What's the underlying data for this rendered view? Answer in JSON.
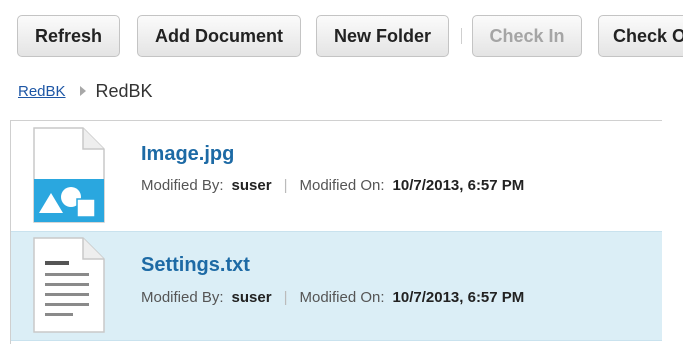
{
  "toolbar": {
    "buttons": [
      {
        "label": "Refresh",
        "enabled": true
      },
      {
        "label": "Add Document",
        "enabled": true
      },
      {
        "label": "New Folder",
        "enabled": true
      },
      {
        "label": "Check In",
        "enabled": false
      },
      {
        "label": "Check O",
        "enabled": true
      }
    ]
  },
  "breadcrumb": {
    "link": "RedBK",
    "current": "RedBK"
  },
  "files": [
    {
      "name": "Image.jpg",
      "icon": "image-file-icon",
      "modified_by_label": "Modified By:",
      "modified_by": "suser",
      "separator": "|",
      "modified_on_label": "Modified On:",
      "modified_on": "10/7/2013, 6:57 PM",
      "selected": false
    },
    {
      "name": "Settings.txt",
      "icon": "text-file-icon",
      "modified_by_label": "Modified By:",
      "modified_by": "suser",
      "separator": "|",
      "modified_on_label": "Modified On:",
      "modified_on": "10/7/2013, 6:57 PM",
      "selected": true
    }
  ],
  "colors": {
    "link": "#1d56a5",
    "file_name": "#1d6aa5",
    "selected_row": "#dbeef6",
    "image_icon_blue": "#2aa7df"
  }
}
